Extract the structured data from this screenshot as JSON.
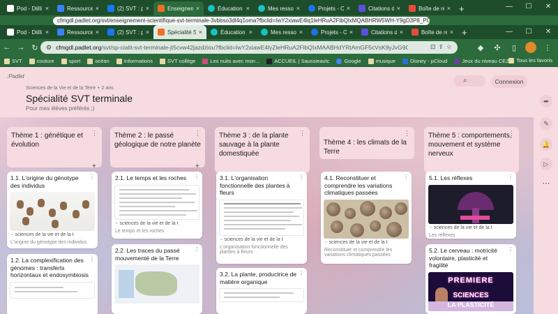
{
  "browser": {
    "tabs_top": [
      {
        "label": "Pod - Diilli À",
        "color": "#ffffff"
      },
      {
        "label": "Ressources",
        "color": "#3b82f6"
      },
      {
        "label": "(2) SVT : part",
        "color": "#1877f2"
      },
      {
        "label": "Enseignemen",
        "color": "#f26d21",
        "active": true
      },
      {
        "label": "Éducation à l",
        "color": "#18c2c2"
      },
      {
        "label": "Mes ressourc",
        "color": "#18c2c2"
      },
      {
        "label": "Projets - Cam",
        "color": "#1a73e8"
      },
      {
        "label": "Citations de P",
        "color": "#5b4fe0"
      },
      {
        "label": "Boîte de récé",
        "color": "#e44d3a"
      }
    ],
    "tabs_second": [
      {
        "label": "Pod - Diilli À",
        "color": "#ffffff"
      },
      {
        "label": "Ressources",
        "color": "#3b82f6"
      },
      {
        "label": "(2) SVT : part",
        "color": "#1877f2"
      },
      {
        "label": "Spécialité SVT",
        "color": "#f26d21",
        "active": true
      },
      {
        "label": "Éducation à l",
        "color": "#18c2c2"
      },
      {
        "label": "Mes ressourc",
        "color": "#18c2c2"
      },
      {
        "label": "Projets - Cam",
        "color": "#1a73e8"
      },
      {
        "label": "Citations de P",
        "color": "#5b4fe0"
      },
      {
        "label": "Boîte de récé",
        "color": "#e44d3a"
      }
    ],
    "ghost_url": "cfmgdl.padlet.org/svt/enseignement-scientifique-svt-terminale-3vbbso3dl4q1oma?fbclid=IwY2xiawE4lq1leHRuA2FlbQlxMQABHRW5WH-Y9gD3P8_POLzQ9LWJlgwI",
    "url_host": "cfmgdl.padlet.org",
    "url_path": "/svt/sp-cialit-svt-terminale-jt5cvw42jazdziou?fbclid=IwY2xiawE4lyZleHRuA2FlbQIxMAABHdYRtAmGF5cVsK9yJvG9OaHIyut0Y1sqztEtpVHOVTiF6gY...",
    "bookmarks": [
      {
        "label": "SVT",
        "type": "folder"
      },
      {
        "label": "couture",
        "type": "folder"
      },
      {
        "label": "sport",
        "type": "folder"
      },
      {
        "label": "océan",
        "type": "folder"
      },
      {
        "label": "Informations",
        "type": "folder"
      },
      {
        "label": "SVT collège",
        "type": "folder"
      },
      {
        "label": "Les nuits avec mon...",
        "type": "link"
      },
      {
        "label": "ACCUEIL | Saussieautc",
        "type": "link"
      },
      {
        "label": "Google",
        "type": "link"
      },
      {
        "label": "musique",
        "type": "folder"
      },
      {
        "label": "Disney - pCloud",
        "type": "link"
      },
      {
        "label": "Jeux du niveau CE2...",
        "type": "link"
      }
    ],
    "all_bookmarks": "Tous les favoris"
  },
  "padlet": {
    "logo": ":Padlet",
    "search_icon": "search-icon",
    "login_label": "Connexion",
    "breadcrumb_author": "Sciences de la Vie et de la Terre",
    "breadcrumb_age": "2 ans",
    "title": "Spécialité SVT terminale",
    "subtitle": "Pour mes élèves préférés ;)",
    "rail_icons": [
      "share-icon",
      "comment-icon",
      "bell-icon",
      "play-icon",
      "more-icon"
    ],
    "columns": [
      {
        "title": "Thème 1 : génétique et évolution",
        "cards": [
          {
            "title": "1.1. L'origine du génotype des individus",
            "thumb": "beans",
            "tag": "sciences de la vie et de la t",
            "caption": "L'origine du génotype des individus"
          },
          {
            "title": "1.2. La complexification des génomes : transferts horizontaux et endosymbiosis",
            "thumb": "doc",
            "tag": "",
            "caption": ""
          }
        ]
      },
      {
        "title": "Thème 2 : le passé géologique de notre planète",
        "cards": [
          {
            "title": "2.1. Le temps et les roches",
            "thumb": "doc",
            "tag": "sciences de la vie et de la t",
            "caption": "Le temps et les roches"
          },
          {
            "title": "2.2. Les traces du passé mouvementé de la Terre",
            "thumb": "map",
            "tag": "",
            "caption": ""
          }
        ]
      },
      {
        "title": "Thème 3 : de la plante sauvage à la plante domestiquée",
        "cards": [
          {
            "title": "3.1. L'organisation fonctionnelle des plantes à fleurs",
            "thumb": "doc",
            "tag": "sciences de la vie et de la t",
            "caption": "L'organisation fonctionnelle des plantes à fleurs"
          },
          {
            "title": "3.2. La plante, productrice de matière organique",
            "thumb": "doc",
            "tag": "",
            "caption": ""
          }
        ]
      },
      {
        "title": "Thème 4 : les climats de la Terre",
        "cards": [
          {
            "title": "4.1. Reconstituer et comprendre les variations climatiques passées",
            "thumb": "pollen",
            "tag": "sciences de la vie et de la t",
            "caption": "Reconstituer et comprendre les variations climatiques passées"
          }
        ]
      },
      {
        "title": "Thème 5 : comportements, mouvement et système nerveux",
        "cards": [
          {
            "title": "5.1. Les réflexes",
            "thumb": "cell",
            "tag": "sciences de la vie et de la t",
            "caption": "Les réflexes"
          },
          {
            "title": "5.2. Le cerveau : motricité volontaire, plasticité et fragilité",
            "thumb": "lecture",
            "thumb_text": [
              "PREMIERE",
              "SCIENCES",
              "LA PLASTICITÉ"
            ],
            "tag": "",
            "caption": ""
          }
        ]
      }
    ]
  }
}
